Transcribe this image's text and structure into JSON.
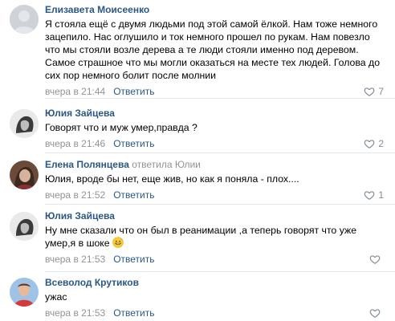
{
  "comments": [
    {
      "author": "Елизавета Моисеенко",
      "text": "Я стояла ещё с двумя людьми под этой самой ёлкой. Нам тоже немного зацепило. Нас оглушило и ток немного прошел по рукам. Нам повезло что мы стояли возле дерева а те люди стояли именно под деревом. Самое страшное что мы могли оказаться на месте тех людей. Голова до сих пор немного болит после молнии",
      "time": "вчера в 21:44",
      "reply_label": "Ответить",
      "likes": "7"
    },
    {
      "author": "Юлия Зайцева",
      "text": "Говорят что и муж умер,правда ?",
      "time": "вчера в 21:46",
      "reply_label": "Ответить",
      "likes": "2"
    },
    {
      "author": "Елена Полянцева",
      "replied_label": "ответила",
      "replied_to": "Юлии",
      "text": "Юлия, вроде бы нет, еще жив, но как я поняла - плох....",
      "time": "вчера в 21:52",
      "reply_label": "Ответить",
      "likes": "1"
    },
    {
      "author": "Юлия Зайцева",
      "text": "Ну мне сказали что он был в реанимации ,а теперь говорят что уже умер,я в шоке",
      "time": "вчера в 21:53",
      "reply_label": "Ответить",
      "likes": ""
    },
    {
      "author": "Всеволод Крутиков",
      "text": "ужас",
      "time": "вчера в 21:53",
      "reply_label": "Ответить",
      "likes": ""
    }
  ],
  "icons": {
    "like": "heart-icon",
    "emoji": "grinning-sweat-emoji"
  },
  "colors": {
    "link": "#2a5885",
    "muted": "#939393",
    "divider": "#e7e8ec"
  }
}
